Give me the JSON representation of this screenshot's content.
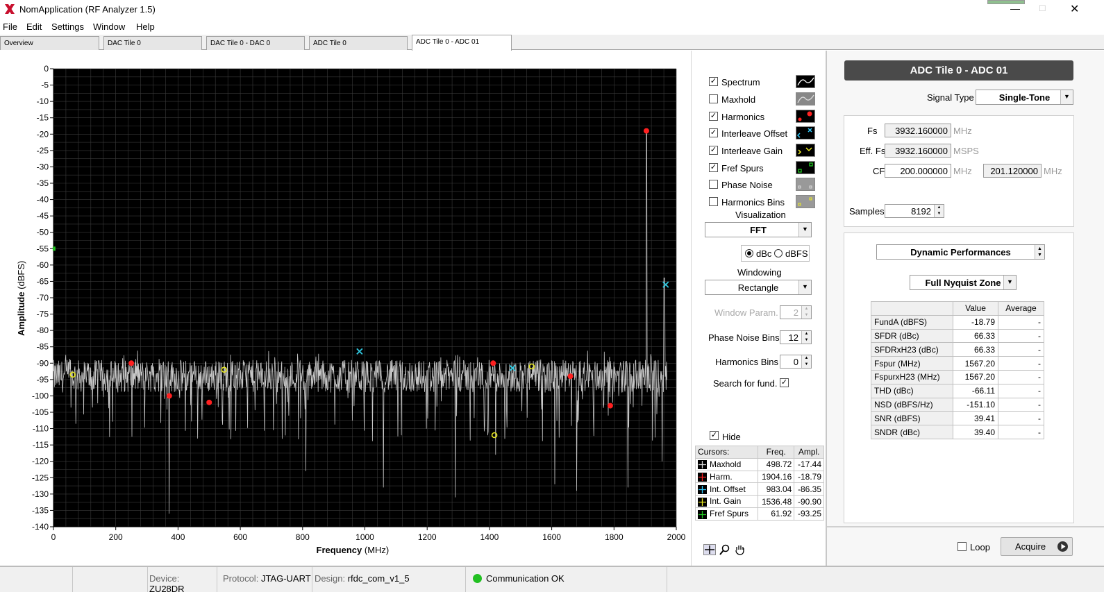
{
  "window": {
    "title": "NomApplication (RF Analyzer 1.5)"
  },
  "menu": [
    "File",
    "Edit",
    "Settings",
    "Window",
    "Help"
  ],
  "tabs": [
    "Overview",
    "DAC Tile 0",
    "DAC Tile 0 - DAC 0",
    "ADC Tile 0",
    "ADC Tile 0 - ADC 01"
  ],
  "chart_data": {
    "type": "line",
    "title": "",
    "xlabel": "Frequency (MHz)",
    "ylabel": "Amplitude (dBFS)",
    "xlim": [
      0,
      2000
    ],
    "ylim": [
      -140,
      0
    ],
    "xticks": [
      "0",
      "200",
      "400",
      "600",
      "800",
      "1000",
      "1200",
      "1400",
      "1600",
      "1800",
      "2000"
    ],
    "yticks": [
      "0",
      "-5",
      "-10",
      "-15",
      "-20",
      "-25",
      "-30",
      "-35",
      "-40",
      "-45",
      "-50",
      "-55",
      "-60",
      "-65",
      "-70",
      "-75",
      "-80",
      "-85",
      "-90",
      "-95",
      "-100",
      "-105",
      "-110",
      "-115",
      "-120",
      "-125",
      "-130",
      "-135",
      "-140"
    ],
    "grid": true,
    "noise_floor": -94,
    "fundamental": {
      "x": 1904.16,
      "y": -18.79
    },
    "series": [
      {
        "values": "spectrum"
      }
    ],
    "markers": [
      {
        "kind": "harmonic",
        "color": "#ff2020",
        "points": [
          [
            1904,
            -19
          ],
          [
            250,
            -90
          ],
          [
            372,
            -100
          ],
          [
            500,
            -102
          ],
          [
            1412,
            -90
          ],
          [
            1660,
            -94
          ],
          [
            1788,
            -103
          ]
        ]
      },
      {
        "kind": "interleave-offset",
        "color": "#30c8e0",
        "points": [
          [
            983,
            -86.4
          ],
          [
            1966,
            -66
          ],
          [
            1474,
            -91.5
          ]
        ]
      },
      {
        "kind": "interleave-gain",
        "color": "#e8e820",
        "points": [
          [
            62,
            -93.5
          ],
          [
            548,
            -92
          ],
          [
            1416,
            -112
          ],
          [
            1536,
            -91
          ]
        ]
      },
      {
        "kind": "fref-spur",
        "color": "#20c020",
        "points": [
          [
            2,
            -55
          ]
        ]
      }
    ]
  },
  "controls": {
    "traces": [
      {
        "label": "Spectrum",
        "checked": true
      },
      {
        "label": "Maxhold",
        "checked": false
      },
      {
        "label": "Harmonics",
        "checked": true
      },
      {
        "label": "Interleave Offset",
        "checked": true
      },
      {
        "label": "Interleave Gain",
        "checked": true
      },
      {
        "label": "Fref Spurs",
        "checked": true
      },
      {
        "label": "Phase Noise",
        "checked": false
      },
      {
        "label": "Harmonics Bins",
        "checked": false
      }
    ],
    "check_mark": "✓",
    "visualization_label": "Visualization",
    "visualization_value": "FFT",
    "unit_dbc": "dBc",
    "unit_dbfs": "dBFS",
    "windowing_label": "Windowing",
    "windowing_value": "Rectangle",
    "window_param_label": "Window Param.",
    "window_param_value": "2",
    "phase_noise_bins_label": "Phase Noise Bins",
    "phase_noise_bins_value": "12",
    "harmonics_bins_label": "Harmonics Bins",
    "harmonics_bins_value": "0",
    "search_fund_label": "Search for fund.",
    "hide_label": "Hide"
  },
  "cursors": {
    "headers": [
      "Cursors:",
      "Freq.",
      "Ampl."
    ],
    "rows": [
      {
        "name": "Maxhold",
        "freq": "498.72",
        "ampl": "-17.44"
      },
      {
        "name": "Harm.",
        "freq": "1904.16",
        "ampl": "-18.79"
      },
      {
        "name": "Int. Offset",
        "freq": "983.04",
        "ampl": "-86.35"
      },
      {
        "name": "Int. Gain",
        "freq": "1536.48",
        "ampl": "-90.90"
      },
      {
        "name": "Fref Spurs",
        "freq": "61.92",
        "ampl": "-93.25"
      }
    ]
  },
  "right": {
    "title": "ADC Tile 0 - ADC 01",
    "signal_type_label": "Signal Type",
    "signal_type_value": "Single-Tone",
    "fs_label": "Fs",
    "fs_value": "3932.160000",
    "fs_unit": "MHz",
    "efffs_label": "Eff. Fs",
    "efffs_value": "3932.160000",
    "efffs_unit": "MSPS",
    "cf_label": "CF",
    "cf_value": "200.000000",
    "cf_unit": "MHz",
    "cf2_value": "201.120000",
    "cf2_unit": "MHz",
    "samples_label": "Samples",
    "samples_value": "8192",
    "dynperf_value": "Dynamic Performances",
    "zone_value": "Full Nyquist Zone",
    "table_headers": [
      "",
      "Value",
      "Average"
    ],
    "metrics": [
      {
        "name": "FundA (dBFS)",
        "value": "-18.79",
        "avg": "-"
      },
      {
        "name": "SFDR (dBc)",
        "value": "66.33",
        "avg": "-"
      },
      {
        "name": "SFDRxH23 (dBc)",
        "value": "66.33",
        "avg": "-"
      },
      {
        "name": "Fspur (MHz)",
        "value": "1567.20",
        "avg": "-"
      },
      {
        "name": "FspurxH23 (MHz)",
        "value": "1567.20",
        "avg": "-"
      },
      {
        "name": "THD (dBc)",
        "value": "-66.11",
        "avg": "-"
      },
      {
        "name": "NSD (dBFS/Hz)",
        "value": "-151.10",
        "avg": "-"
      },
      {
        "name": "SNR (dBFS)",
        "value": "39.41",
        "avg": "-"
      },
      {
        "name": "SNDR (dBc)",
        "value": "39.40",
        "avg": "-"
      }
    ],
    "loop_label": "Loop",
    "acquire_label": "Acquire"
  },
  "status": {
    "device_label": "Device:",
    "device_value": "ZU28DR",
    "protocol_label": "Protocol:",
    "protocol_value": "JTAG-UART",
    "design_label": "Design:",
    "design_value": "rfdc_com_v1_5",
    "comm_value": "Communication OK"
  },
  "colors": {
    "plot_bg": "#000000",
    "grid": "#3a3a3a",
    "trace": "#c8c8c8",
    "panel_title_bg": "#4a4a4a",
    "status_ok": "#22c022"
  }
}
